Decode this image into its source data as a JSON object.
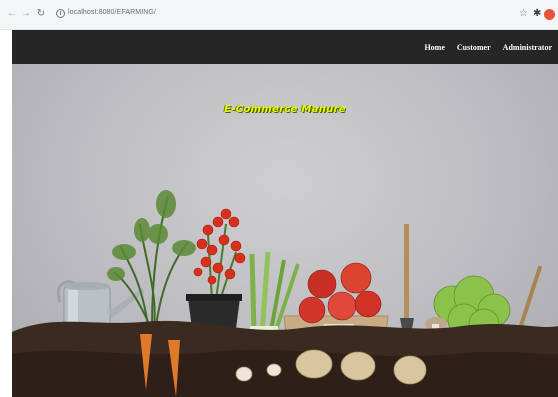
{
  "browser": {
    "url": "localhost:8080/EFARMING/"
  },
  "navbar": {
    "links": [
      "Home",
      "Customer",
      "Administrator"
    ]
  },
  "hero": {
    "title": "E-Commerce Manure"
  },
  "colors": {
    "navbar_bg": "#262626",
    "title_color": "#e6ff00",
    "soil": "#3b2a1f"
  }
}
